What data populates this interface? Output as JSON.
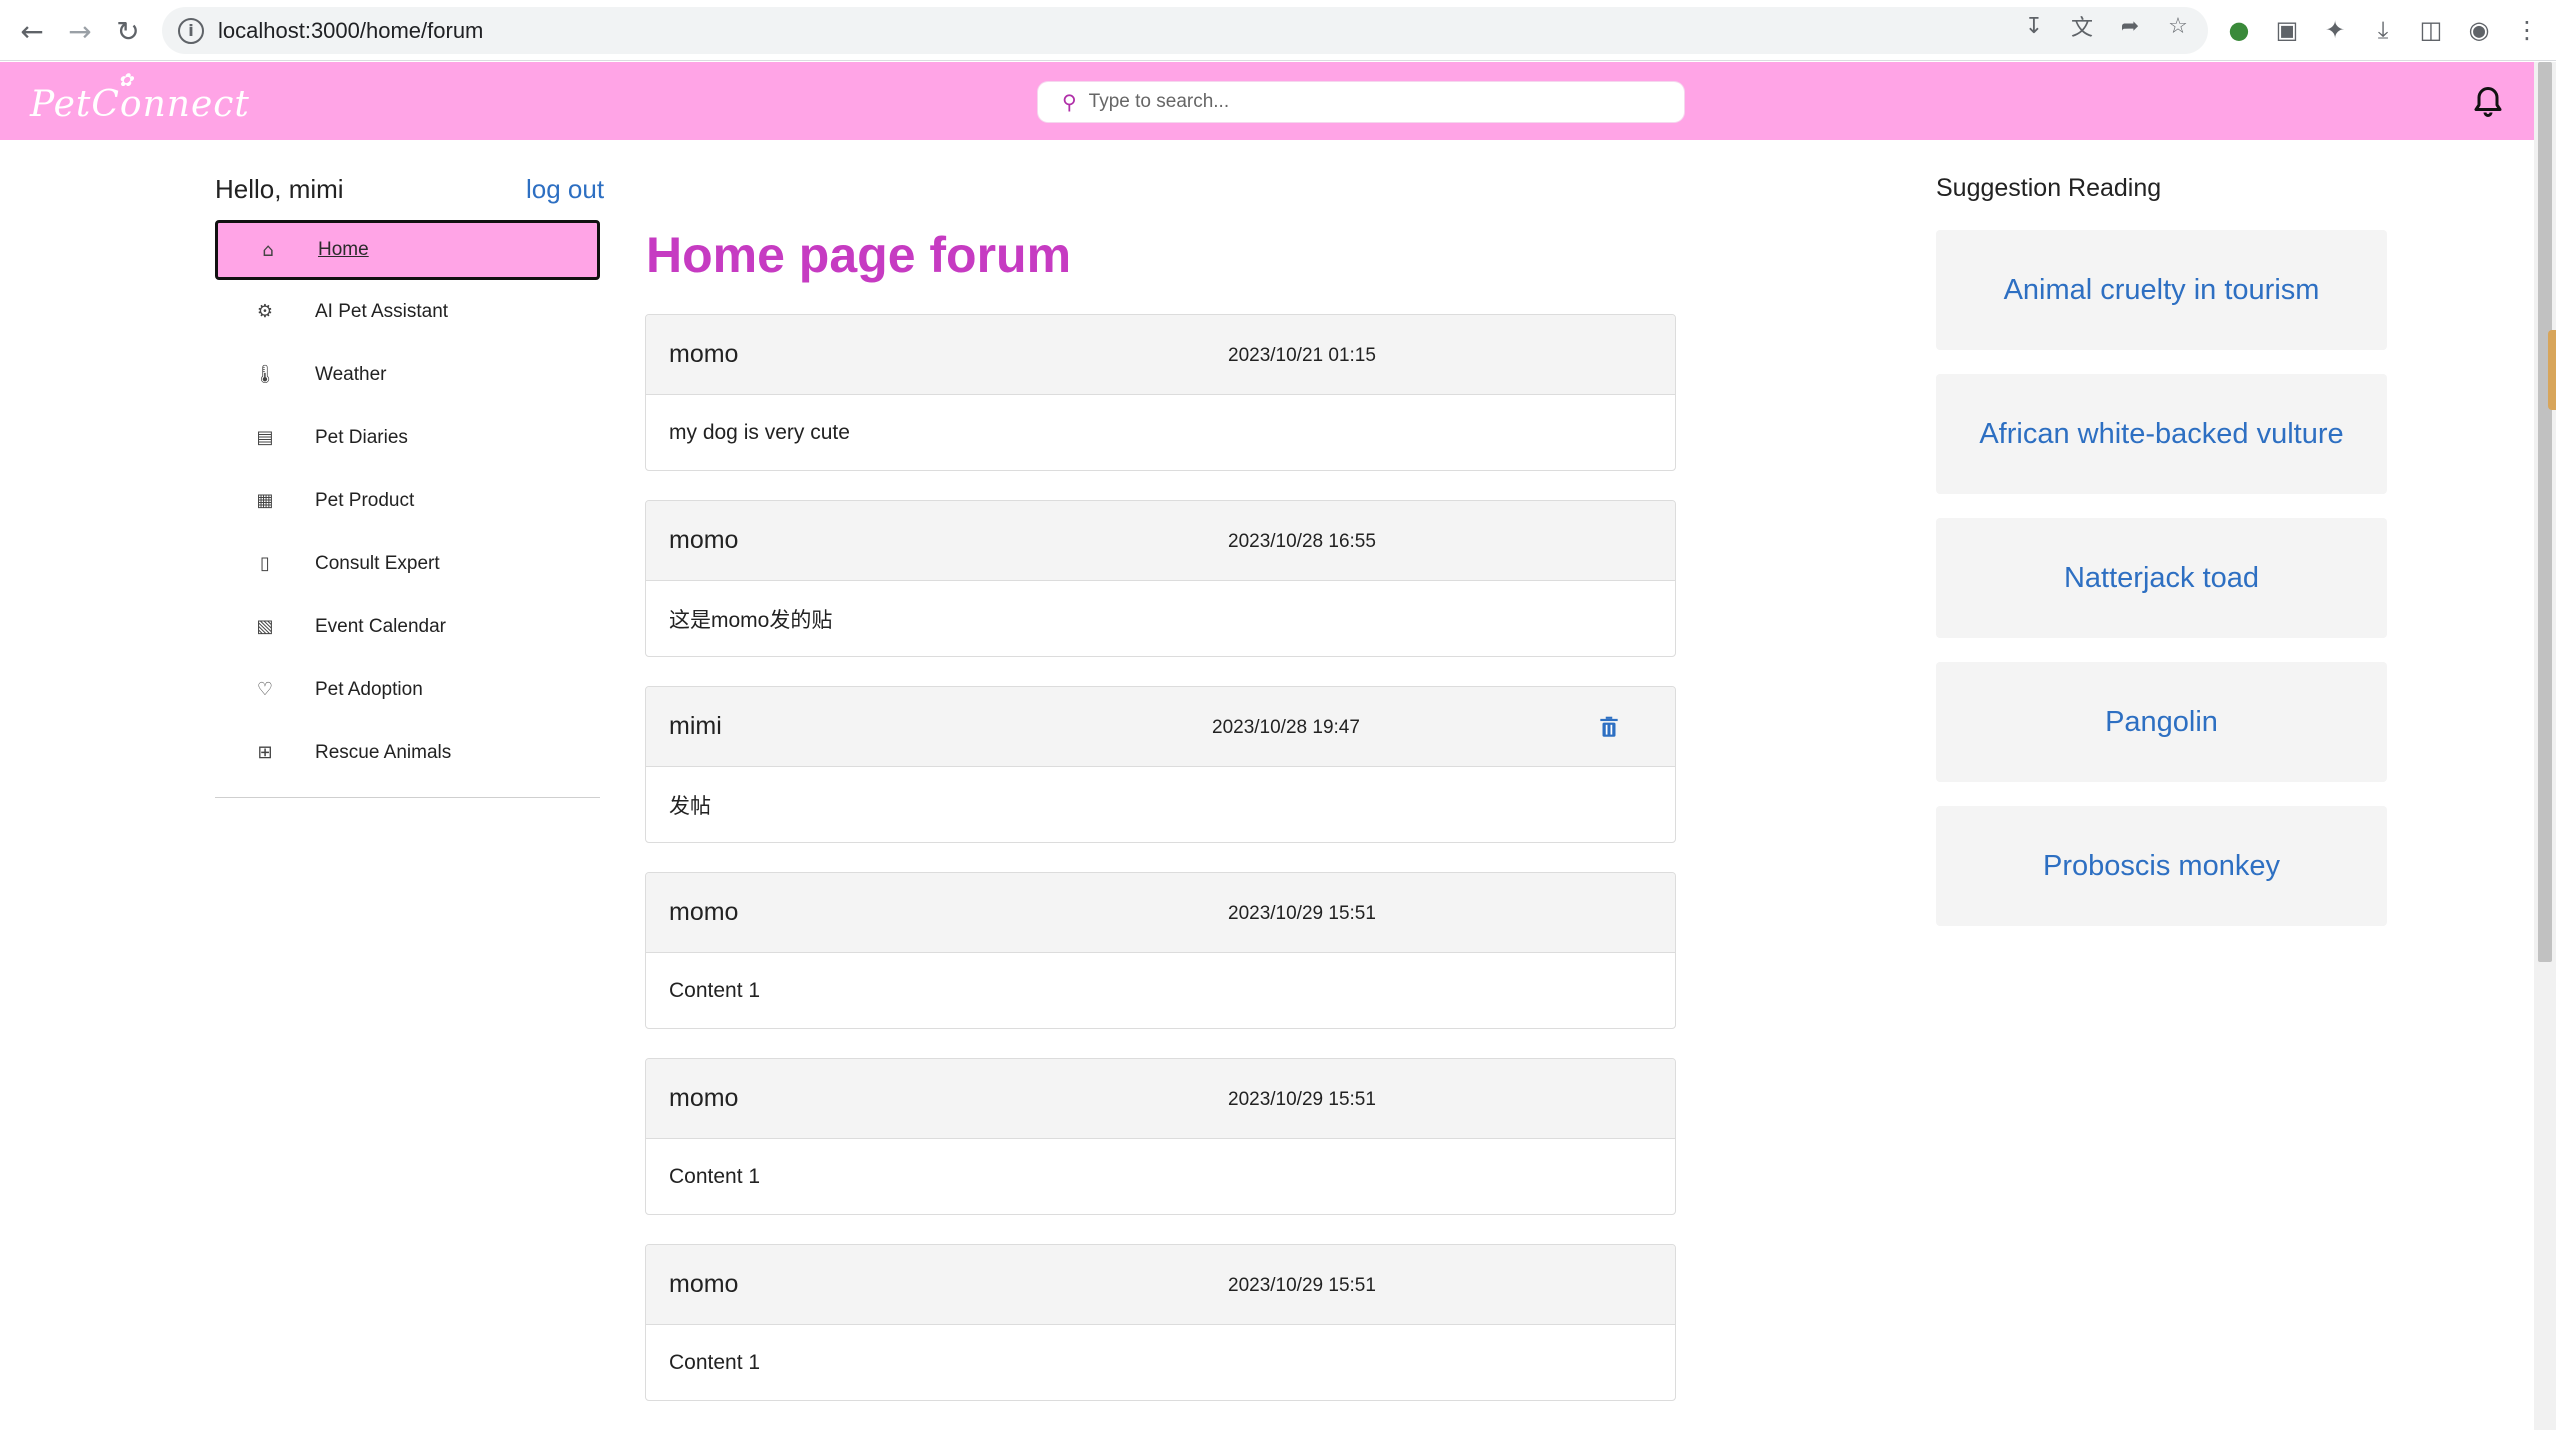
{
  "browser": {
    "url": "localhost:3000/home/forum",
    "icons": [
      "back-arrow-icon",
      "forward-arrow-icon",
      "reload-icon",
      "site-info-icon",
      "install-icon",
      "translate-icon",
      "share-icon",
      "bookmark-star-icon",
      "extension-globe-icon",
      "extension-card-icon",
      "extensions-puzzle-icon",
      "downloads-icon",
      "side-panel-icon",
      "profile-icon",
      "menu-kebab-icon"
    ]
  },
  "header": {
    "logo": "PetConnect",
    "search_placeholder": "Type to search...",
    "accent_color": "#ffa4e6"
  },
  "sidebar": {
    "greeting": "Hello, mimi",
    "logout_label": "log out",
    "items": [
      {
        "label": "Home",
        "icon": "home-icon",
        "active": true
      },
      {
        "label": "AI Pet Assistant",
        "icon": "robot-icon",
        "active": false
      },
      {
        "label": "Weather",
        "icon": "thermometer-icon",
        "active": false
      },
      {
        "label": "Pet Diaries",
        "icon": "diary-icon",
        "active": false
      },
      {
        "label": "Pet Product",
        "icon": "product-chart-icon",
        "active": false
      },
      {
        "label": "Consult Expert",
        "icon": "chat-icon",
        "active": false
      },
      {
        "label": "Event Calendar",
        "icon": "calendar-icon",
        "active": false
      },
      {
        "label": "Pet Adoption",
        "icon": "heart-icon",
        "active": false
      },
      {
        "label": "Rescue Animals",
        "icon": "medical-plus-icon",
        "active": false
      }
    ]
  },
  "forum": {
    "title": "Home page forum",
    "title_color": "#c63bc2",
    "posts": [
      {
        "author": "momo",
        "date": "2023/10/21 01:15",
        "content": "my dog is very cute",
        "deletable": false
      },
      {
        "author": "momo",
        "date": "2023/10/28 16:55",
        "content": "这是momo发的贴",
        "deletable": false
      },
      {
        "author": "mimi",
        "date": "2023/10/28 19:47",
        "content": "发帖",
        "deletable": true
      },
      {
        "author": "momo",
        "date": "2023/10/29 15:51",
        "content": "Content 1",
        "deletable": false
      },
      {
        "author": "momo",
        "date": "2023/10/29 15:51",
        "content": "Content 1",
        "deletable": false
      },
      {
        "author": "momo",
        "date": "2023/10/29 15:51",
        "content": "Content 1",
        "deletable": false
      }
    ]
  },
  "suggestions": {
    "title": "Suggestion Reading",
    "link_color": "#2d6fc2",
    "items": [
      "Animal cruelty in tourism",
      "African white-backed vulture",
      "Natterjack toad",
      "Pangolin",
      "Proboscis monkey"
    ]
  }
}
